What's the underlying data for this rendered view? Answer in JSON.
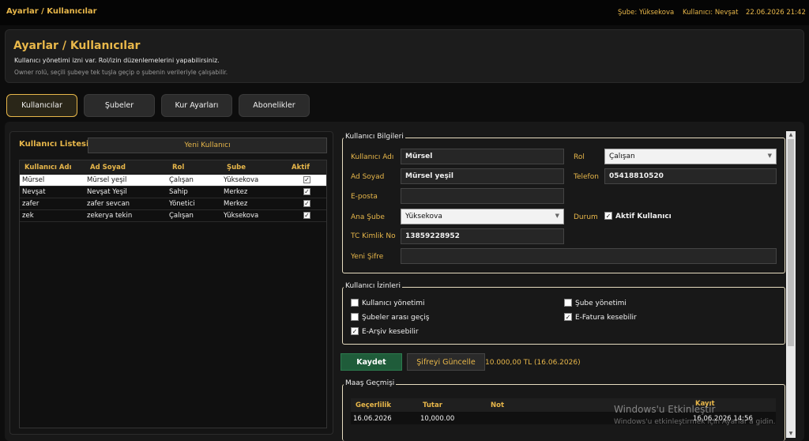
{
  "topbar": {
    "title": "Ayarlar / Kullanıcılar",
    "branch": "Şube: Yüksekova",
    "user": "Kullanıcı: Nevşat",
    "datetime": "22.06.2026 21:42"
  },
  "header": {
    "title": "Ayarlar / Kullanıcılar",
    "desc1": "Kullanıcı yönetimi izni var. Rol/izin düzenlemelerini yapabilirsiniz.",
    "desc2": "Owner rolü, seçili şubeye tek tuşla geçip o şubenin verileriyle çalışabilir."
  },
  "tabs": [
    {
      "label": "Kullanıcılar",
      "active": true
    },
    {
      "label": "Şubeler",
      "active": false
    },
    {
      "label": "Kur Ayarları",
      "active": false
    },
    {
      "label": "Abonelikler",
      "active": false
    }
  ],
  "user_list": {
    "title": "Kullanıcı Listesi",
    "new_button": "Yeni Kullanıcı",
    "columns": [
      "Kullanıcı Adı",
      "Ad Soyad",
      "Rol",
      "Şube",
      "Aktif"
    ],
    "rows": [
      {
        "username": "Mürsel",
        "fullname": "Mürsel yeşil",
        "role": "Çalışan",
        "branch": "Yüksekova",
        "active": "✓",
        "selected": true
      },
      {
        "username": "Nevşat",
        "fullname": "Nevşat Yeşil",
        "role": "Sahip",
        "branch": "Merkez",
        "active": "✓",
        "selected": false
      },
      {
        "username": "zafer",
        "fullname": "zafer sevcan",
        "role": "Yönetici",
        "branch": "Merkez",
        "active": "✓",
        "selected": false
      },
      {
        "username": "zek",
        "fullname": "zekerya tekin",
        "role": "Çalışan",
        "branch": "Yüksekova",
        "active": "✓",
        "selected": false
      }
    ]
  },
  "user_info": {
    "legend": "Kullanıcı Bilgileri",
    "username_label": "Kullanıcı Adı",
    "username_value": "Mürsel",
    "fullname_label": "Ad Soyad",
    "fullname_value": "Mürsel yeşil",
    "email_label": "E-posta",
    "email_value": "",
    "branch_label": "Ana Şube",
    "branch_value": "Yüksekova",
    "tc_label": "TC Kimlik No",
    "tc_value": "13859228952",
    "password_label": "Yeni Şifre",
    "password_value": "",
    "role_label": "Rol",
    "role_value": "Çalışan",
    "phone_label": "Telefon",
    "phone_value": "05418810520",
    "status_label": "Durum",
    "active_label": "Aktif Kullanıcı",
    "active_checked": "✓"
  },
  "permissions": {
    "legend": "Kullanıcı İzinleri",
    "items": [
      {
        "label": "Kullanıcı yönetimi",
        "checked": ""
      },
      {
        "label": "Şubeler arası geçiş",
        "checked": ""
      },
      {
        "label": "E-Arşiv kesebilir",
        "checked": "✓"
      },
      {
        "label": "Şube yönetimi",
        "checked": ""
      },
      {
        "label": "E-Fatura kesebilir",
        "checked": "✓"
      }
    ]
  },
  "actions": {
    "save": "Kaydet",
    "update_password": "Şifreyi Güncelle",
    "salary_info": "10.000,00 TL (16.06.2026)"
  },
  "salary_history": {
    "legend": "Maaş Geçmişi",
    "columns": [
      "Geçerlilik",
      "Tutar",
      "Not",
      "Kayıt"
    ],
    "rows": [
      {
        "date": "16.06.2026",
        "amount": "10,000.00",
        "note": "",
        "record": "16.06.2026 14:56"
      }
    ]
  },
  "watermark": {
    "line1": "Windows'u Etkinleştir",
    "line2": "Windows'u etkinleştirmek için Ayarlar'a gidin."
  }
}
